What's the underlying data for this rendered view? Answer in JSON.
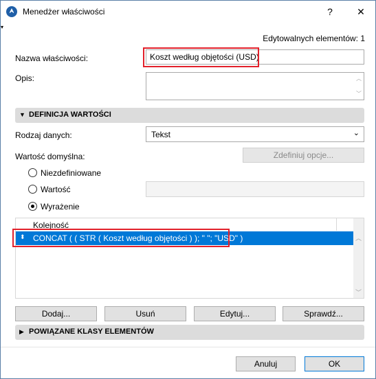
{
  "window": {
    "title": "Menedżer właściwości",
    "help": "?",
    "close": "✕"
  },
  "editable_count": "Edytowalnych elementów: 1",
  "property_name": {
    "label": "Nazwa właściwości:",
    "value": "Koszt według objętości (USD)"
  },
  "description": {
    "label": "Opis:",
    "value": ""
  },
  "value_definition": {
    "title": "DEFINICJA WARTOŚCI",
    "data_type_label": "Rodzaj danych:",
    "data_type_value": "Tekst",
    "default_value_label": "Wartość domyślna:",
    "define_options_button": "Zdefiniuj opcje...",
    "radios": [
      {
        "label": "Niezdefiniowane",
        "checked": false
      },
      {
        "label": "Wartość",
        "checked": false
      },
      {
        "label": "Wyrażenie",
        "checked": true
      }
    ],
    "value_input": "",
    "list_header": "Kolejność",
    "expression": "CONCAT ( ( STR ( Koszt według objętości ) ); \" \"; \"USD\" )"
  },
  "buttons": {
    "add": "Dodaj...",
    "remove": "Usuń",
    "edit": "Edytuj...",
    "check": "Sprawdź..."
  },
  "related_classes": {
    "title": "POWIĄZANE KLASY ELEMENTÓW"
  },
  "footer": {
    "cancel": "Anuluj",
    "ok": "OK"
  },
  "colors": {
    "highlight": "#e2202a",
    "selection": "#0078d7"
  }
}
